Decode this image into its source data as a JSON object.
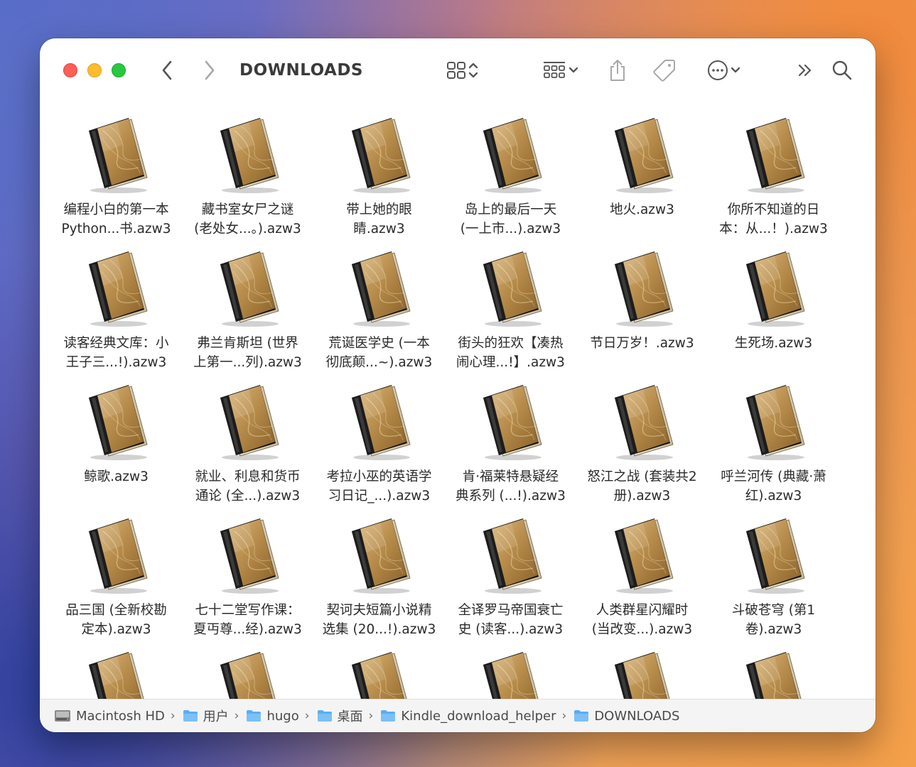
{
  "window": {
    "title": "DOWNLOADS"
  },
  "toolbar": {
    "back": "chevron-left-icon",
    "forward": "chevron-right-icon",
    "view": "icon-grid-icon",
    "group": "group-by-icon",
    "share": "share-icon",
    "tag": "tag-icon",
    "more": "ellipsis-circle-icon",
    "overflow": "double-chevron-right-icon",
    "search": "search-icon"
  },
  "files": [
    {
      "label": "编程小白的第一本\nPython...书.azw3"
    },
    {
      "label": "藏书室女尸之谜\n(老处女...。).azw3"
    },
    {
      "label": "带上她的眼\n睛.azw3"
    },
    {
      "label": "岛上的最后一天\n(一上市...).azw3"
    },
    {
      "label": "地火.azw3"
    },
    {
      "label": "你所不知道的日\n本：从...！).azw3"
    },
    {
      "label": "读客经典文库：小\n王子三...!).azw3"
    },
    {
      "label": "弗兰肯斯坦 (世界\n上第一...列).azw3"
    },
    {
      "label": "荒诞医学史 (一本\n彻底颠...~).azw3"
    },
    {
      "label": "街头的狂欢【凑热\n闹心理...!】.azw3"
    },
    {
      "label": "节日万岁！.azw3"
    },
    {
      "label": "生死场.azw3"
    },
    {
      "label": "鲸歌.azw3"
    },
    {
      "label": "就业、利息和货币\n通论 (全...).azw3"
    },
    {
      "label": "考拉小巫的英语学\n习日记_...).azw3"
    },
    {
      "label": "肯·福莱特悬疑经\n典系列 (...!).azw3"
    },
    {
      "label": "怒江之战 (套装共2\n册).azw3"
    },
    {
      "label": "呼兰河传 (典藏·萧\n红).azw3"
    },
    {
      "label": "品三国 (全新校勘\n定本).azw3"
    },
    {
      "label": "七十二堂写作课：\n夏丏尊...经).azw3"
    },
    {
      "label": "契诃夫短篇小说精\n选集 (20...!).azw3"
    },
    {
      "label": "全译罗马帝国衰亡\n史 (读客...).azw3"
    },
    {
      "label": "人类群星闪耀时\n(当改变...).azw3"
    },
    {
      "label": "斗破苍穹 (第1\n卷).azw3"
    },
    {
      "label": ""
    },
    {
      "label": ""
    },
    {
      "label": ""
    },
    {
      "label": ""
    },
    {
      "label": ""
    },
    {
      "label": ""
    }
  ],
  "pathbar": {
    "items": [
      {
        "label": "Macintosh HD",
        "icon": "hard-drive-icon"
      },
      {
        "label": "用户",
        "icon": "folder-icon"
      },
      {
        "label": "hugo",
        "icon": "folder-icon"
      },
      {
        "label": "桌面",
        "icon": "folder-icon"
      },
      {
        "label": "Kindle_download_helper",
        "icon": "folder-icon"
      },
      {
        "label": "DOWNLOADS",
        "icon": "folder-icon"
      }
    ],
    "separator": "›"
  }
}
